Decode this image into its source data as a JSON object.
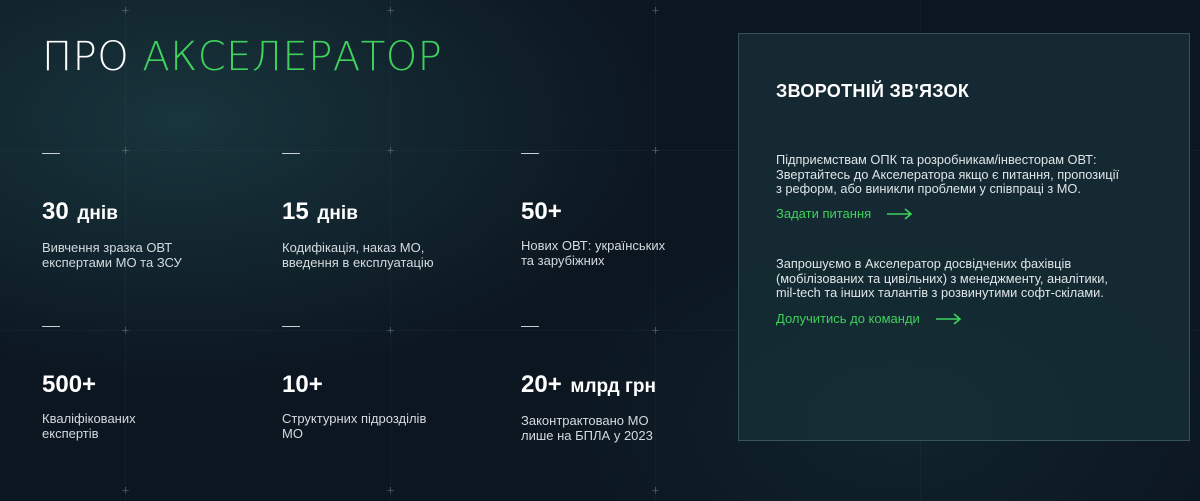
{
  "section": {
    "title_prefix": "ПРО",
    "title_accent": "АКСЕЛЕРАТОР"
  },
  "stats": [
    {
      "value": "30",
      "unit": "днів",
      "description": "Вивчення зразка ОВТ\nекспертами МО та ЗСУ"
    },
    {
      "value": "15",
      "unit": "днів",
      "description": "Кодифікація, наказ МО,\nвведення в експлуатацію"
    },
    {
      "value": "50+",
      "unit": "",
      "description": "Нових ОВТ: українських\nта зарубіжних"
    },
    {
      "value": "500+",
      "unit": "",
      "description": "Кваліфікованих\nекспертів"
    },
    {
      "value": "10+",
      "unit": "",
      "description": "Структурних підрозділів\nМО"
    },
    {
      "value": "20+",
      "unit": "млрд грн",
      "description": "Законтрактовано МО\nлише на БПЛА у 2023"
    }
  ],
  "feedback": {
    "title": "ЗВОРОТНІЙ ЗВ'ЯЗОК",
    "paragraph_1": "Підприємствам ОПК та розробникам/інвесторам ОВТ:\nЗвертайтесь до Акселератора якщо є питання, пропозиції\nз реформ, або виникли проблеми у співпраці з МО.",
    "link_1": "Задати питання",
    "paragraph_2": "Запрошуємо в Акселератор досвідчених фахівців\n(мобілізованих та цивільних) з менеджменту, аналітики,\nmil-tech та інших талантів з розвинутими софт-скілами.",
    "link_2": "Долучитись до команди"
  },
  "colors": {
    "accent": "#3fd15c",
    "background": "#0c1620",
    "panel": "#1b3640"
  },
  "icons": [
    "arrow-right-icon"
  ]
}
